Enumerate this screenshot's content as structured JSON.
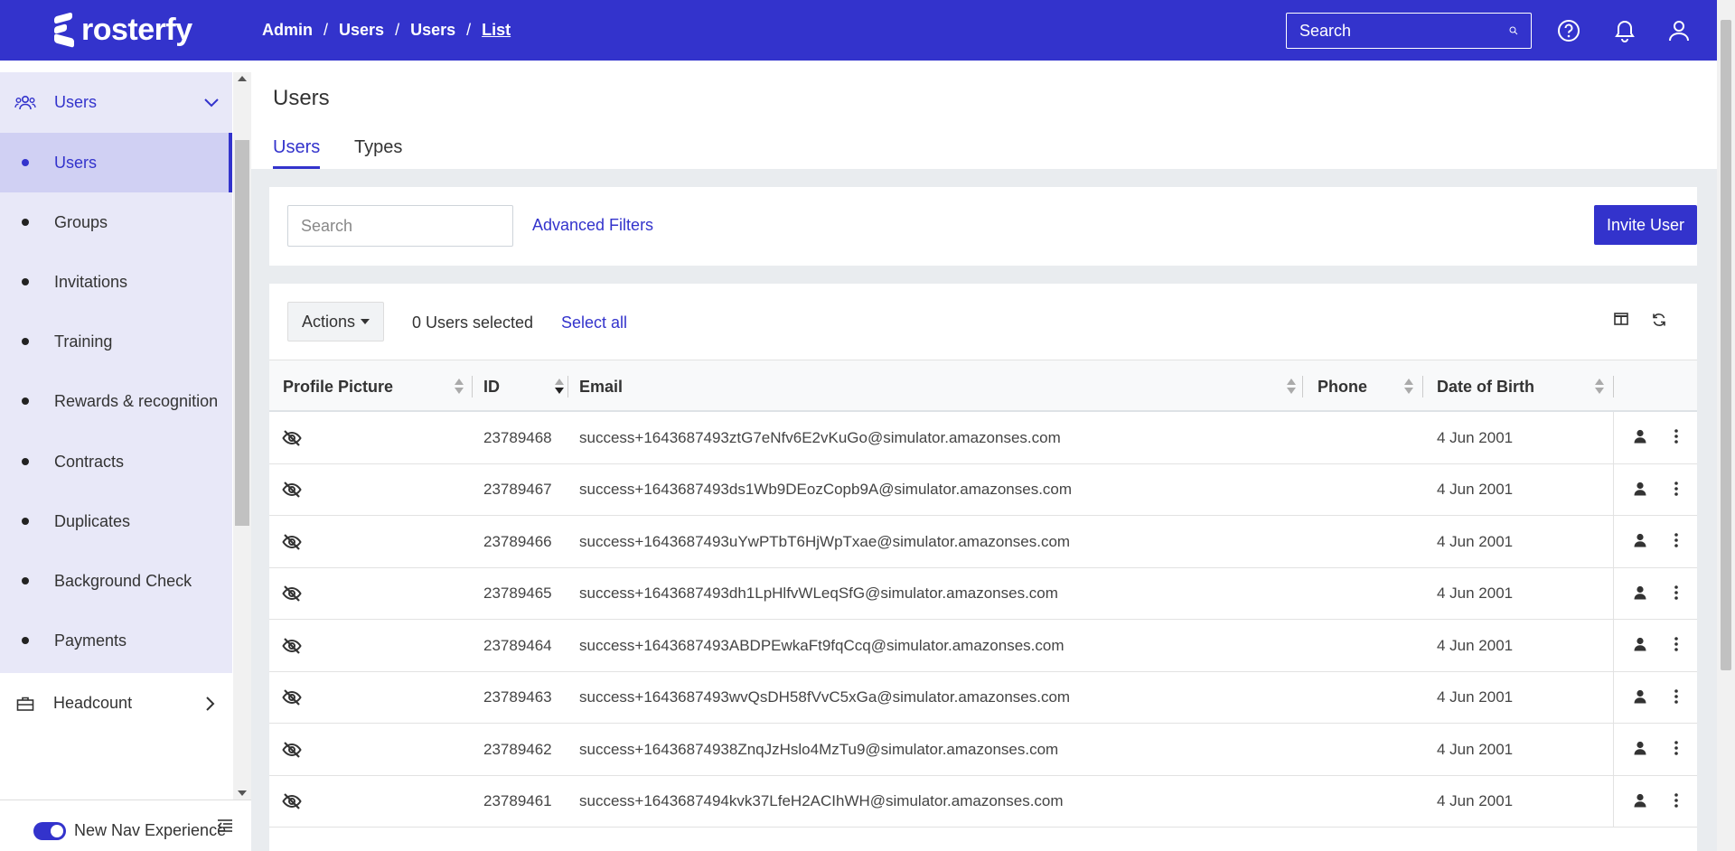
{
  "app": {
    "brand": "rosterfy",
    "breadcrumb": [
      "Admin",
      "Users",
      "Users",
      "List"
    ],
    "top_search_placeholder": "Search",
    "icons": {
      "search": "search-icon",
      "help": "help-circle-icon",
      "bell": "bell-icon",
      "user": "user-icon"
    }
  },
  "sidebar": {
    "group_label": "Users",
    "items": [
      {
        "label": "Users",
        "active": true
      },
      {
        "label": "Groups"
      },
      {
        "label": "Invitations"
      },
      {
        "label": "Training"
      },
      {
        "label": "Rewards & recognition"
      },
      {
        "label": "Contracts"
      },
      {
        "label": "Duplicates"
      },
      {
        "label": "Background Check"
      },
      {
        "label": "Payments"
      }
    ],
    "headcount_label": "Headcount",
    "toggle_label": "New Nav Experience"
  },
  "page": {
    "title": "Users",
    "tabs": [
      {
        "label": "Users",
        "active": true
      },
      {
        "label": "Types"
      }
    ]
  },
  "filters": {
    "search_placeholder": "Search",
    "advanced_label": "Advanced Filters",
    "invite_label": "Invite User"
  },
  "table_tools": {
    "actions_label": "Actions",
    "selected_text": "0 Users selected",
    "select_all_label": "Select all"
  },
  "table": {
    "columns": [
      "Profile Picture",
      "ID",
      "Email",
      "Phone",
      "Date of Birth"
    ],
    "sorted_column": "ID",
    "sort_direction": "desc",
    "rows": [
      {
        "id": "23789468",
        "email": "success+1643687493ztG7eNfv6E2vKuGo@simulator.amazonses.com",
        "phone": "",
        "dob": "4 Jun 2001"
      },
      {
        "id": "23789467",
        "email": "success+1643687493ds1Wb9DEozCopb9A@simulator.amazonses.com",
        "phone": "",
        "dob": "4 Jun 2001"
      },
      {
        "id": "23789466",
        "email": "success+1643687493uYwPTbT6HjWpTxae@simulator.amazonses.com",
        "phone": "",
        "dob": "4 Jun 2001"
      },
      {
        "id": "23789465",
        "email": "success+1643687493dh1LpHlfvWLeqSfG@simulator.amazonses.com",
        "phone": "",
        "dob": "4 Jun 2001"
      },
      {
        "id": "23789464",
        "email": "success+1643687493ABDPEwkaFt9fqCcq@simulator.amazonses.com",
        "phone": "",
        "dob": "4 Jun 2001"
      },
      {
        "id": "23789463",
        "email": "success+1643687493wvQsDH58fVvC5xGa@simulator.amazonses.com",
        "phone": "",
        "dob": "4 Jun 2001"
      },
      {
        "id": "23789462",
        "email": "success+16436874938ZnqJzHslo4MzTu9@simulator.amazonses.com",
        "phone": "",
        "dob": "4 Jun 2001"
      },
      {
        "id": "23789461",
        "email": "success+1643687494kvk37LfeH2ACIhWH@simulator.amazonses.com",
        "phone": "",
        "dob": "4 Jun 2001"
      }
    ]
  },
  "colors": {
    "brand": "#3333cc",
    "sidebar_group": "#e8e8f8",
    "sidebar_active": "#d0d0f3"
  }
}
